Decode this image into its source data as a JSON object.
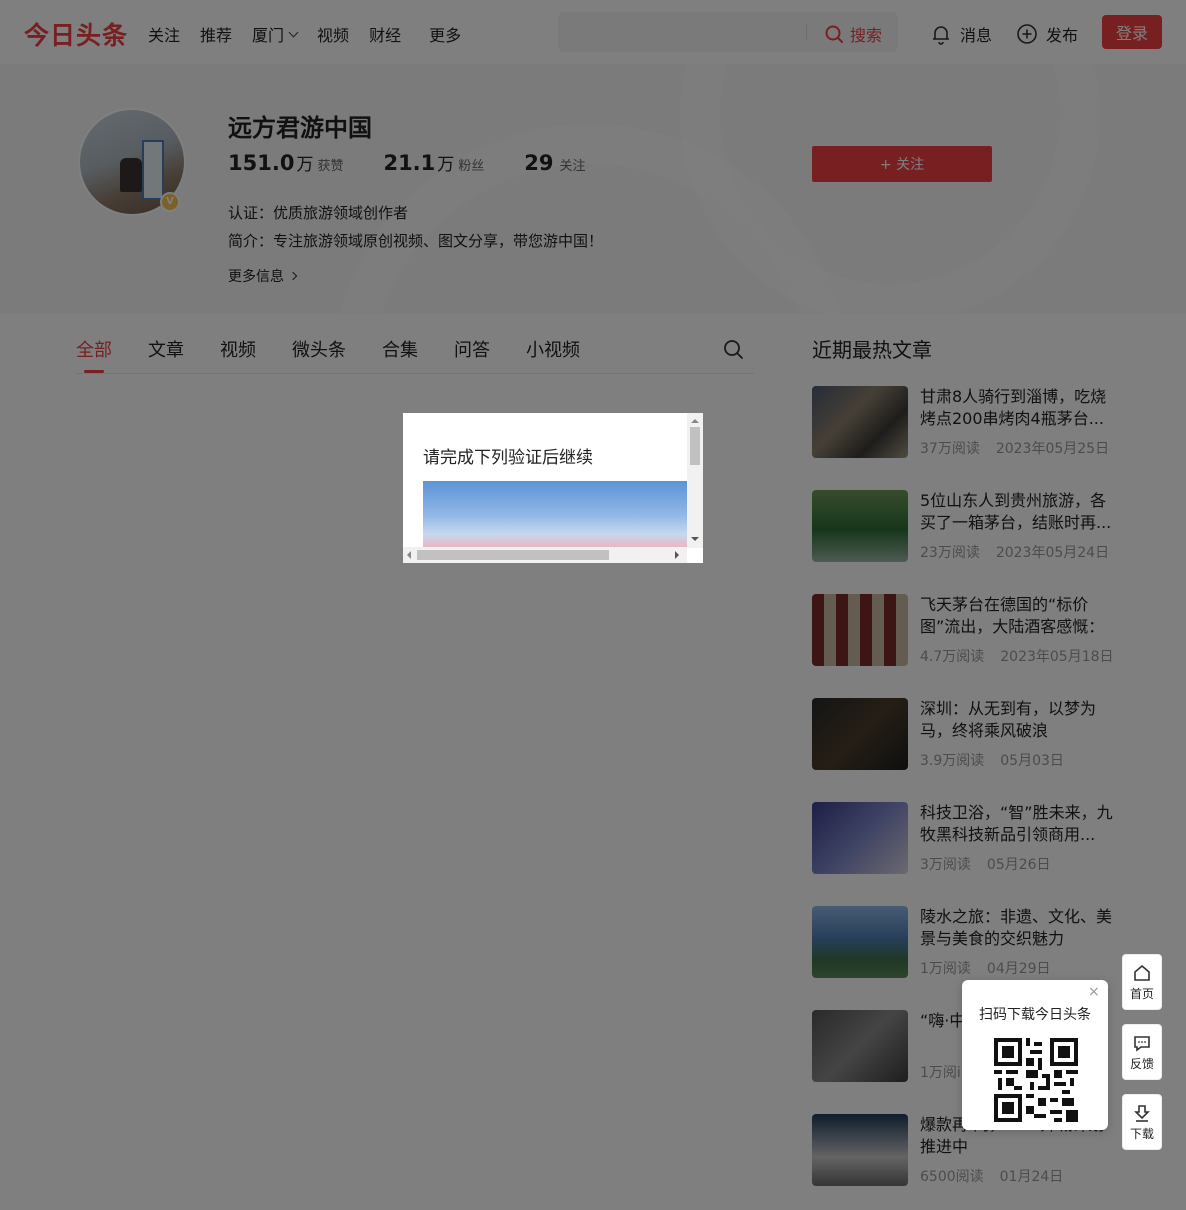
{
  "header": {
    "logo": "今日头条",
    "nav": [
      "关注",
      "推荐",
      "厦门",
      "视频",
      "财经"
    ],
    "nav_more": "更多",
    "search_placeholder": "",
    "search_button": "搜索",
    "messages": "消息",
    "publish": "发布",
    "login": "登录"
  },
  "profile": {
    "name": "远方君游中国",
    "stats": [
      {
        "num": "151.0",
        "unit": "万",
        "label": "获赞"
      },
      {
        "num": "21.1",
        "unit": "万",
        "label": "粉丝"
      },
      {
        "num": "29",
        "unit": "",
        "label": "关注"
      }
    ],
    "certification": "认证：优质旅游领域创作者",
    "bio": "简介：专注旅游领域原创视频、图文分享，带您游中国！",
    "more_info": "更多信息",
    "follow_button": "+ 关注",
    "verified_badge": "V"
  },
  "tabs": [
    "全部",
    "文章",
    "视频",
    "微头条",
    "合集",
    "问答",
    "小视频"
  ],
  "active_tab": "全部",
  "hot": {
    "title": "近期最热文章",
    "articles": [
      {
        "title": "甘肃8人骑行到淄博，吃烧烤点200串烤肉4瓶茅台...",
        "views": "37万阅读",
        "date": "2023年05月25日"
      },
      {
        "title": "5位山东人到贵州旅游，各买了一箱茅台，结账时再...",
        "views": "23万阅读",
        "date": "2023年05月24日"
      },
      {
        "title": "飞天茅台在德国的“标价图”流出，大陆酒客感慨：人...",
        "views": "4.7万阅读",
        "date": "2023年05月18日"
      },
      {
        "title": "深圳：从无到有，以梦为马，终将乘风破浪",
        "views": "3.9万阅读",
        "date": "05月03日"
      },
      {
        "title": "科技卫浴，“智”胜未来，九牧黑科技新品引领商用...",
        "views": "3万阅读",
        "date": "05月26日"
      },
      {
        "title": "陵水之旅：非遗、文化、美景与美食的交织魅力",
        "views": "1万阅读",
        "date": "04月29日"
      },
      {
        "title": "“嗨·中 官，以",
        "views": "1万阅i",
        "date": ""
      },
      {
        "title": "爆款再 肉，NOA开城计划推进中",
        "views": "6500阅读",
        "date": "01月24日"
      }
    ]
  },
  "modal": {
    "title": "请完成下列验证后继续"
  },
  "qr": {
    "title": "扫码下载今日头条",
    "close": "×"
  },
  "side": {
    "home": "首页",
    "feedback": "反馈",
    "download": "下载"
  },
  "colors": {
    "brand": "#f04142",
    "overlay": "rgba(0,0,0,0.5)"
  }
}
